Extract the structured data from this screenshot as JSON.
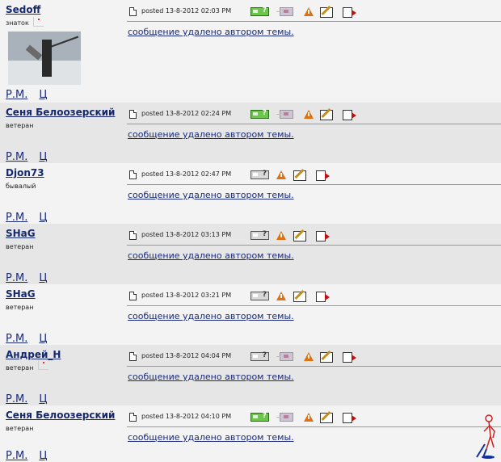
{
  "posts": [
    {
      "author": "Sedoff",
      "rank": "знаток",
      "posted": "posted 13-8-2012 02:03 PM",
      "message": "сообщение удалено автором темы.",
      "pm_link": "Р.М.",
      "quote_link": "Ц",
      "online": true,
      "bg": "norm",
      "has_avatar": true,
      "has_rank_icon": true
    },
    {
      "author": "Сеня Белоозерский",
      "rank": "ветеран",
      "posted": "posted 13-8-2012 02:24 PM",
      "message": "сообщение удалено автором темы.",
      "pm_link": "Р.М.",
      "quote_link": "Ц",
      "online": true,
      "bg": "alt",
      "has_avatar": false,
      "has_rank_icon": false
    },
    {
      "author": "Djon73",
      "rank": "бывалый",
      "posted": "posted 13-8-2012 02:47 PM",
      "message": "сообщение удалено автором темы.",
      "pm_link": "Р.М.",
      "quote_link": "Ц",
      "online": false,
      "bg": "norm",
      "has_avatar": false,
      "has_rank_icon": false
    },
    {
      "author": "SHaG",
      "rank": "ветеран",
      "posted": "posted 13-8-2012 03:13 PM",
      "message": "сообщение удалено автором темы.",
      "pm_link": "Р.М.",
      "quote_link": "Ц",
      "online": false,
      "bg": "alt",
      "has_avatar": false,
      "has_rank_icon": false
    },
    {
      "author": "SHaG",
      "rank": "ветеран",
      "posted": "posted 13-8-2012 03:21 PM",
      "message": "сообщение удалено автором темы.",
      "pm_link": "Р.М.",
      "quote_link": "Ц",
      "online": false,
      "bg": "norm",
      "has_avatar": false,
      "has_rank_icon": false
    },
    {
      "author": "Андрей_Н",
      "rank": "ветеран",
      "posted": "posted 13-8-2012 04:04 PM",
      "message": "сообщение удалено автором темы.",
      "pm_link": "Р.М.",
      "quote_link": "Ц",
      "online": false,
      "bg": "alt",
      "has_avatar": false,
      "has_rank_icon": true
    },
    {
      "author": "Сеня Белоозерский",
      "rank": "ветеран",
      "posted": "posted 13-8-2012 04:10 PM",
      "message": "сообщение удалено автором темы.",
      "pm_link": "Р.М.",
      "quote_link": "Ц",
      "online": true,
      "bg": "norm",
      "has_avatar": false,
      "has_rank_icon": false
    }
  ],
  "colors": {
    "link": "#17296e",
    "alt_row": "#e6e6e6",
    "norm_row": "#f3f3f3",
    "online_icon": "#6cc64a",
    "report_icon": "#e07010"
  },
  "icons": [
    "document-icon",
    "online-status-icon",
    "offline-status-icon",
    "private-message-icon",
    "report-icon",
    "edit-icon",
    "quote-icon"
  ]
}
